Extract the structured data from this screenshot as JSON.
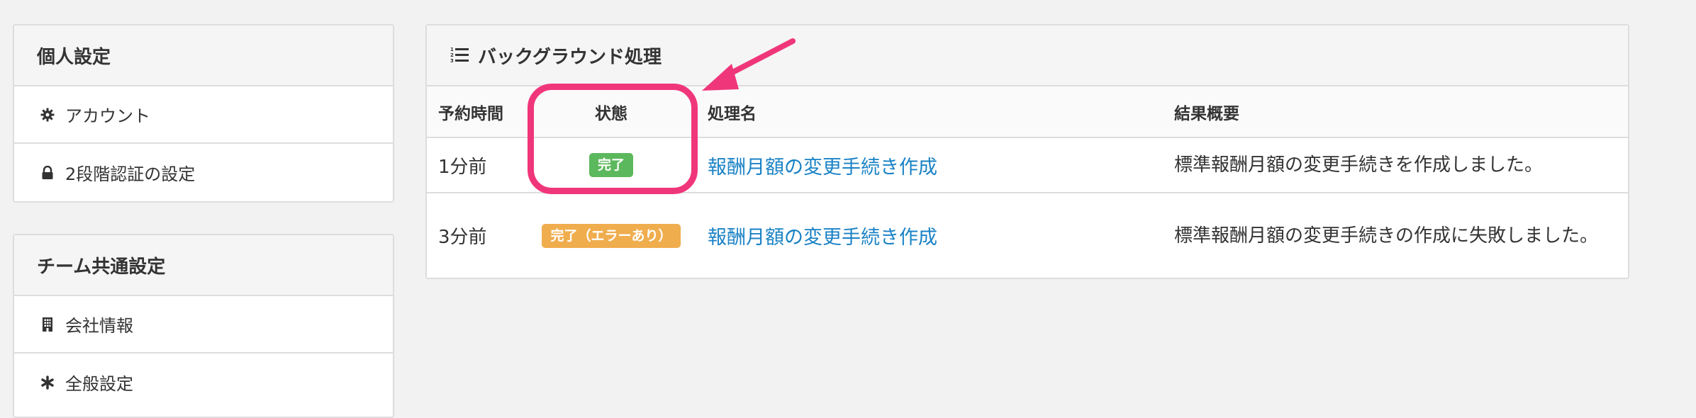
{
  "personal_settings": {
    "title": "個人設定",
    "items": [
      {
        "label": "アカウント",
        "icon": "gear-icon"
      },
      {
        "label": "2段階認証の設定",
        "icon": "lock-icon"
      }
    ]
  },
  "team_settings": {
    "title": "チーム共通設定",
    "items": [
      {
        "label": "会社情報",
        "icon": "building-icon"
      },
      {
        "label": "全般設定",
        "icon": "asterisk-icon"
      }
    ]
  },
  "background_jobs": {
    "title": "バックグラウンド処理",
    "icon": "ordered-list-icon",
    "columns": {
      "scheduled_time": "予約時間",
      "status": "状態",
      "job_name": "処理名",
      "result_summary": "結果概要"
    },
    "rows": [
      {
        "scheduled_time": "1分前",
        "status": "完了",
        "status_color": "#5cb85c",
        "job_name": "報酬月額の変更手続き作成",
        "result_summary": "標準報酬月額の変更手続きを作成しました。"
      },
      {
        "scheduled_time": "3分前",
        "status": "完了（エラーあり）",
        "status_color": "#f0ad4e",
        "job_name": "報酬月額の変更手続き作成",
        "result_summary": "標準報酬月額の変更手続きの作成に失敗しました。"
      }
    ]
  },
  "annotation": {
    "color": "#f0367a"
  },
  "colors": {
    "link": "#1a82c5",
    "success": "#5cb85c",
    "warning": "#f0ad4e"
  }
}
